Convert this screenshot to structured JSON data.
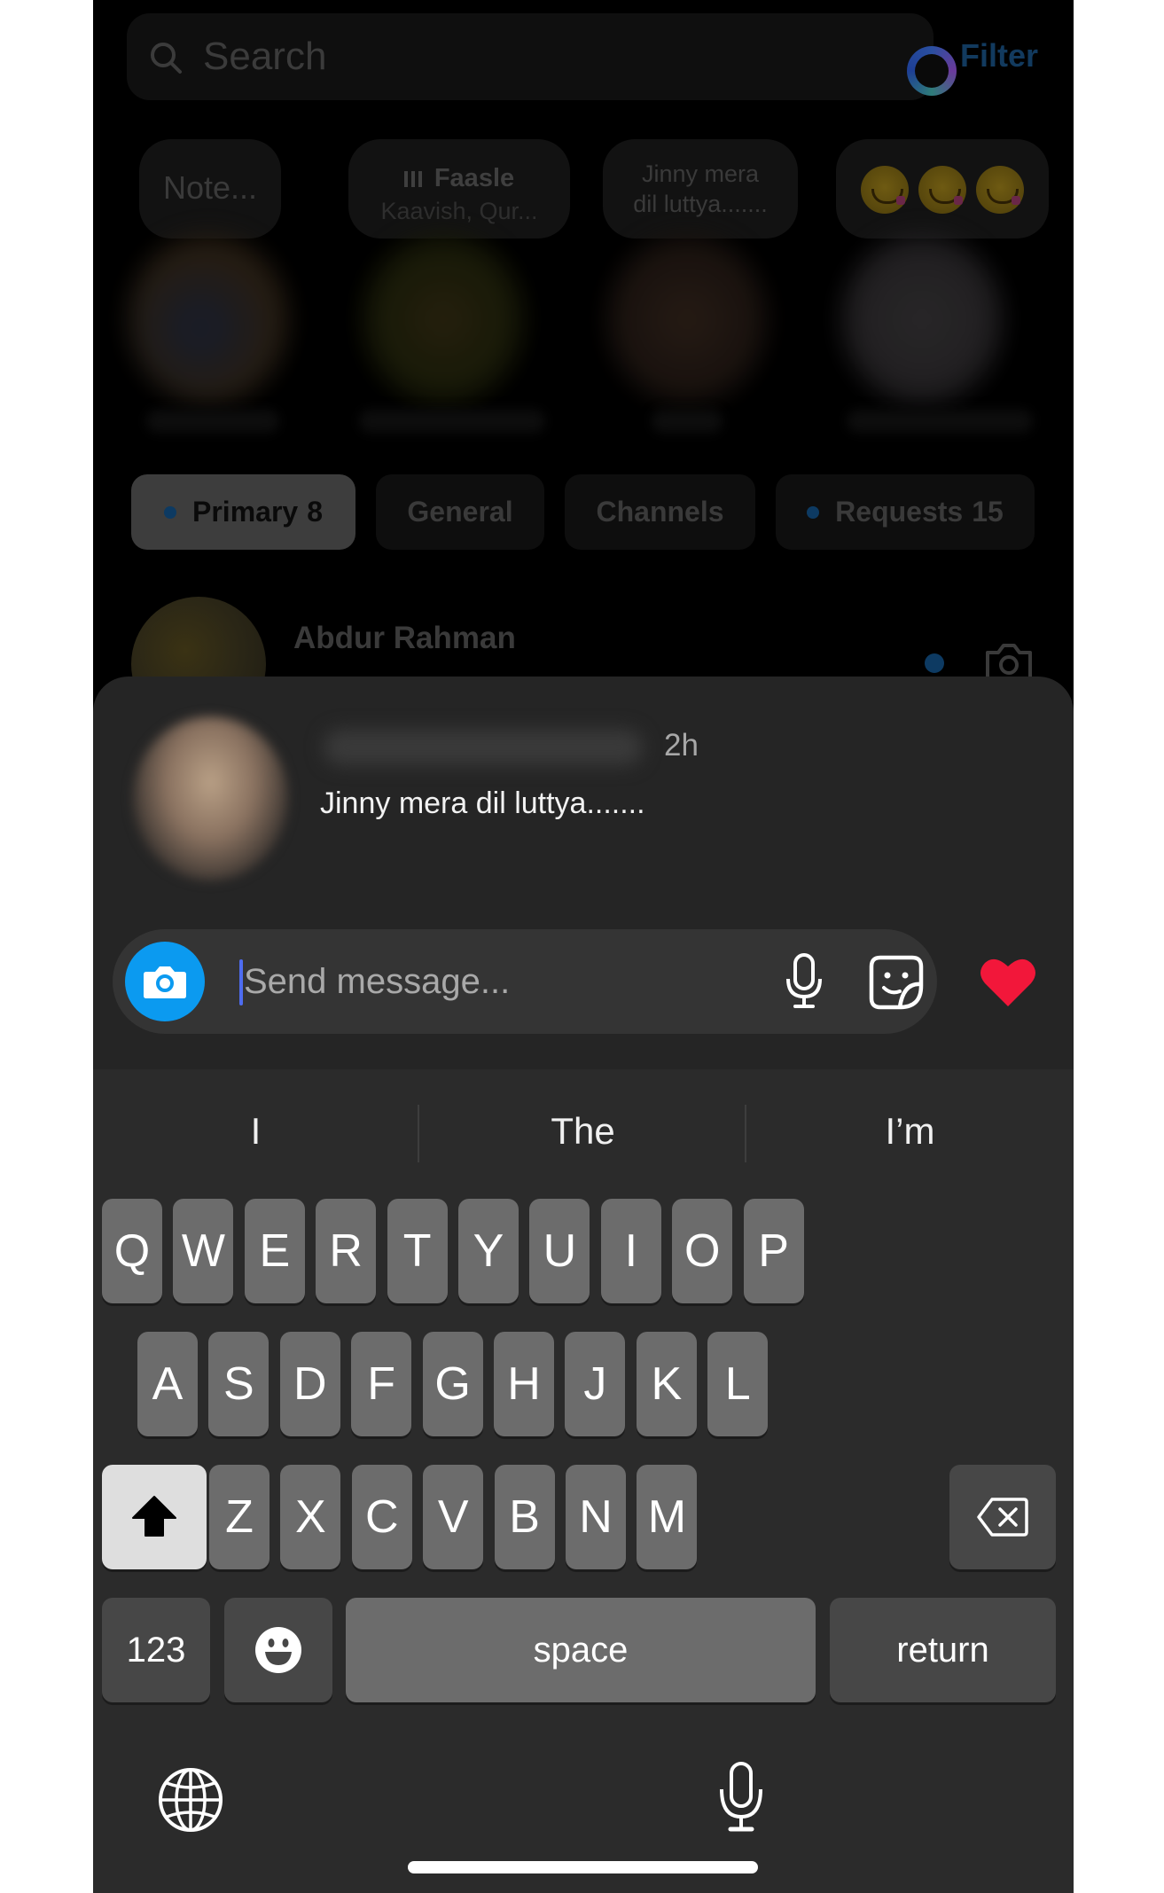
{
  "inbox": {
    "search": {
      "placeholder": "Search"
    },
    "filter_label": "Filter",
    "notes": [
      {
        "text": "Note..."
      },
      {
        "title": "Faasle",
        "subtitle": "Kaavish, Qur..."
      },
      {
        "line1": "Jinny mera",
        "line2": "dil luttya......."
      },
      {
        "emoji": "😋😋😋"
      }
    ],
    "tabs": [
      {
        "label": "Primary",
        "count": "8",
        "unread_dot": true,
        "active": true
      },
      {
        "label": "General",
        "count": "",
        "unread_dot": false,
        "active": false
      },
      {
        "label": "Channels",
        "count": "",
        "unread_dot": false,
        "active": false
      },
      {
        "label": "Requests",
        "count": "15",
        "unread_dot": true,
        "active": false
      }
    ],
    "thread": {
      "name": "Abdur Rahman"
    }
  },
  "reply_sheet": {
    "time": "2h",
    "message": "Jinny mera dil luttya.......",
    "input_placeholder": "Send message...",
    "input_value": ""
  },
  "keyboard": {
    "suggestions": [
      "I",
      "The",
      "I’m"
    ],
    "row1": [
      "Q",
      "W",
      "E",
      "R",
      "T",
      "Y",
      "U",
      "I",
      "O",
      "P"
    ],
    "row2": [
      "A",
      "S",
      "D",
      "F",
      "G",
      "H",
      "J",
      "K",
      "L"
    ],
    "row3": [
      "Z",
      "X",
      "C",
      "V",
      "B",
      "N",
      "M"
    ],
    "numbers_label": "123",
    "space_label": "space",
    "return_label": "return"
  },
  "colors": {
    "camera_button": "#0b9af0",
    "heart": "#f2173a",
    "caret": "#4e6cf0",
    "unread_dot": "#0d3a62"
  }
}
